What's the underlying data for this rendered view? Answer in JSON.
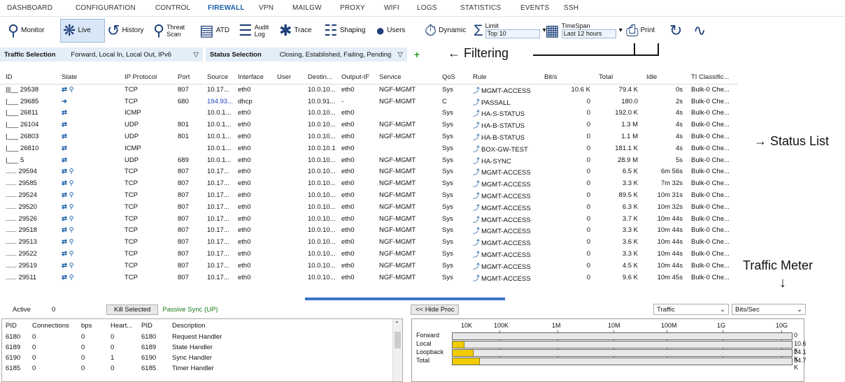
{
  "menu": [
    "DASHBOARD",
    "CONFIGURATION",
    "CONTROL",
    "FIREWALL",
    "VPN",
    "MAILGW",
    "PROXY",
    "WIFI",
    "LOGS",
    "STATISTICS",
    "EVENTS",
    "SSH"
  ],
  "toolbar": {
    "monitor": "Monitor",
    "live": "Live",
    "history": "History",
    "threat_l1": "Threat",
    "threat_l2": "Scan",
    "atd": "ATD",
    "audit_l1": "Audit",
    "audit_l2": "Log",
    "trace": "Trace",
    "shaping": "Shaping",
    "users": "Users",
    "dynamic": "Dynamic",
    "limit_label": "Limit",
    "limit_value": "Top 10",
    "timespan_label": "TimeSpan",
    "timespan_value": "Last 12 hours",
    "print": "Print"
  },
  "filter": {
    "traffic_label": "Traffic Selection",
    "traffic_value": "Forward, Local In, Local Out, IPv6",
    "status_label": "Status Selection",
    "status_value": "Closing, Established, Failing, Pending"
  },
  "annotations": {
    "filtering": "Filtering",
    "status_list": "Status List",
    "traffic_meter": "Traffic Meter"
  },
  "columns": [
    "ID",
    "State",
    "IP Protocol",
    "Port",
    "Source",
    "Interface",
    "User",
    "Destin...",
    "Output-IF",
    "Service",
    "QoS",
    "Rule",
    "Bit/s",
    "Total",
    "Idle",
    "TI Classific..."
  ],
  "rows": [
    {
      "id": "29538",
      "mark": "|||__",
      "proto": "TCP",
      "port": "807",
      "src": "10.17...",
      "if": "eth0",
      "user": "",
      "dst": "10.0.10...",
      "oif": "eth0",
      "svc": "NGF-MGMT",
      "qos": "Sys",
      "rule": "MGMT-ACCESS",
      "bits": "10.6 K",
      "total": "79.4 K",
      "idle": "0s",
      "ti": "Bulk-0 Che..."
    },
    {
      "id": "29685",
      "mark": "|___",
      "proto": "TCP",
      "port": "680",
      "src": "194.93...",
      "if": "dhcp",
      "user": "",
      "dst": "10.0.91....",
      "oif": "-",
      "svc": "NGF-MGMT",
      "qos": "C",
      "rule": "PASSALL",
      "bits": "0",
      "total": "180.0",
      "idle": "2s",
      "ti": "Bulk-0 Che..."
    },
    {
      "id": "26811",
      "mark": "|___",
      "proto": "ICMP",
      "port": "",
      "src": "10.0.1...",
      "if": "eth0",
      "user": "",
      "dst": "10.0.10...",
      "oif": "eth0",
      "svc": "",
      "qos": "Sys",
      "rule": "HA-S-STATUS",
      "bits": "0",
      "total": "192.0 K",
      "idle": "4s",
      "ti": "Bulk-0 Che..."
    },
    {
      "id": "26104",
      "mark": "|___",
      "proto": "UDP",
      "port": "801",
      "src": "10.0.1...",
      "if": "eth0",
      "user": "",
      "dst": "10.0.10...",
      "oif": "eth0",
      "svc": "NGF-MGMT",
      "qos": "Sys",
      "rule": "HA-B-STATUS",
      "bits": "0",
      "total": "1.3 M",
      "idle": "4s",
      "ti": "Bulk-0 Che..."
    },
    {
      "id": "26803",
      "mark": "|___",
      "proto": "UDP",
      "port": "801",
      "src": "10.0.1...",
      "if": "eth0",
      "user": "",
      "dst": "10.0.10...",
      "oif": "eth0",
      "svc": "NGF-MGMT",
      "qos": "Sys",
      "rule": "HA-B-STATUS",
      "bits": "0",
      "total": "1.1 M",
      "idle": "4s",
      "ti": "Bulk-0 Che..."
    },
    {
      "id": "26810",
      "mark": "|___",
      "proto": "ICMP",
      "port": "",
      "src": "10.0.1...",
      "if": "eth0",
      "user": "",
      "dst": "10.0.10.1",
      "oif": "eth0",
      "svc": "",
      "qos": "Sys",
      "rule": "BOX-GW-TEST",
      "bits": "0",
      "total": "181.1 K",
      "idle": "4s",
      "ti": "Bulk-0 Che..."
    },
    {
      "id": "5",
      "mark": "|___",
      "proto": "UDP",
      "port": "689",
      "src": "10.0.1...",
      "if": "eth0",
      "user": "",
      "dst": "10.0.10...",
      "oif": "eth0",
      "svc": "NGF-MGMT",
      "qos": "Sys",
      "rule": "HA-SYNC",
      "bits": "0",
      "total": "28.9 M",
      "idle": "5s",
      "ti": "Bulk-0 Che..."
    },
    {
      "id": "29594",
      "mark": "......",
      "proto": "TCP",
      "port": "807",
      "src": "10.17...",
      "if": "eth0",
      "user": "",
      "dst": "10.0.10...",
      "oif": "eth0",
      "svc": "NGF-MGMT",
      "qos": "Sys",
      "rule": "MGMT-ACCESS",
      "bits": "0",
      "total": "6.5 K",
      "idle": "6m 56s",
      "ti": "Bulk-0 Che..."
    },
    {
      "id": "29585",
      "mark": "......",
      "proto": "TCP",
      "port": "807",
      "src": "10.17...",
      "if": "eth0",
      "user": "",
      "dst": "10.0.10...",
      "oif": "eth0",
      "svc": "NGF-MGMT",
      "qos": "Sys",
      "rule": "MGMT-ACCESS",
      "bits": "0",
      "total": "3.3 K",
      "idle": "7m 32s",
      "ti": "Bulk-0 Che..."
    },
    {
      "id": "29524",
      "mark": "......",
      "proto": "TCP",
      "port": "807",
      "src": "10.17...",
      "if": "eth0",
      "user": "",
      "dst": "10.0.10...",
      "oif": "eth0",
      "svc": "NGF-MGMT",
      "qos": "Sys",
      "rule": "MGMT-ACCESS",
      "bits": "0",
      "total": "89.5 K",
      "idle": "10m 31s",
      "ti": "Bulk-0 Che..."
    },
    {
      "id": "29520",
      "mark": "......",
      "proto": "TCP",
      "port": "807",
      "src": "10.17...",
      "if": "eth0",
      "user": "",
      "dst": "10.0.10...",
      "oif": "eth0",
      "svc": "NGF-MGMT",
      "qos": "Sys",
      "rule": "MGMT-ACCESS",
      "bits": "0",
      "total": "6.3 K",
      "idle": "10m 32s",
      "ti": "Bulk-0 Che..."
    },
    {
      "id": "29526",
      "mark": "......",
      "proto": "TCP",
      "port": "807",
      "src": "10.17...",
      "if": "eth0",
      "user": "",
      "dst": "10.0.10...",
      "oif": "eth0",
      "svc": "NGF-MGMT",
      "qos": "Sys",
      "rule": "MGMT-ACCESS",
      "bits": "0",
      "total": "3.7 K",
      "idle": "10m 44s",
      "ti": "Bulk-0 Che..."
    },
    {
      "id": "29518",
      "mark": "......",
      "proto": "TCP",
      "port": "807",
      "src": "10.17...",
      "if": "eth0",
      "user": "",
      "dst": "10.0.10...",
      "oif": "eth0",
      "svc": "NGF-MGMT",
      "qos": "Sys",
      "rule": "MGMT-ACCESS",
      "bits": "0",
      "total": "3.3 K",
      "idle": "10m 44s",
      "ti": "Bulk-0 Che..."
    },
    {
      "id": "29513",
      "mark": "......",
      "proto": "TCP",
      "port": "807",
      "src": "10.17...",
      "if": "eth0",
      "user": "",
      "dst": "10.0.10...",
      "oif": "eth0",
      "svc": "NGF-MGMT",
      "qos": "Sys",
      "rule": "MGMT-ACCESS",
      "bits": "0",
      "total": "3.6 K",
      "idle": "10m 44s",
      "ti": "Bulk-0 Che..."
    },
    {
      "id": "29522",
      "mark": "......",
      "proto": "TCP",
      "port": "807",
      "src": "10.17...",
      "if": "eth0",
      "user": "",
      "dst": "10.0.10...",
      "oif": "eth0",
      "svc": "NGF-MGMT",
      "qos": "Sys",
      "rule": "MGMT-ACCESS",
      "bits": "0",
      "total": "3.3 K",
      "idle": "10m 44s",
      "ti": "Bulk-0 Che..."
    },
    {
      "id": "29519",
      "mark": "......",
      "proto": "TCP",
      "port": "807",
      "src": "10.17...",
      "if": "eth0",
      "user": "",
      "dst": "10.0.10...",
      "oif": "eth0",
      "svc": "NGF-MGMT",
      "qos": "Sys",
      "rule": "MGMT-ACCESS",
      "bits": "0",
      "total": "4.5 K",
      "idle": "10m 44s",
      "ti": "Bulk-0 Che..."
    },
    {
      "id": "29511",
      "mark": "......",
      "proto": "TCP",
      "port": "807",
      "src": "10.17...",
      "if": "eth0",
      "user": "",
      "dst": "10.0.10...",
      "oif": "eth0",
      "svc": "NGF-MGMT",
      "qos": "Sys",
      "rule": "MGMT-ACCESS",
      "bits": "0",
      "total": "9.6 K",
      "idle": "10m 45s",
      "ti": "Bulk-0 Che..."
    }
  ],
  "bottom_left": {
    "active_label": "Active",
    "active_value": "0",
    "kill": "Kill Selected",
    "sync": "Passive Sync (UP)",
    "columns": [
      "PID",
      "Connections",
      "bps",
      "Heart...",
      "PID",
      "Description"
    ],
    "rows": [
      [
        "6180",
        "0",
        "0",
        "0",
        "6180",
        "Request Handler"
      ],
      [
        "6189",
        "0",
        "0",
        "0",
        "6189",
        "State Handler"
      ],
      [
        "6190",
        "0",
        "0",
        "1",
        "6190",
        "Sync Handler"
      ],
      [
        "6185",
        "0",
        "0",
        "0",
        "6185",
        "Timer Handler"
      ]
    ]
  },
  "bottom_right": {
    "hide_proc": "<< Hide Proc",
    "traffic_select": "Traffic",
    "unit_select": "Bits/Sec",
    "scale": [
      "10K",
      "100K",
      "1M",
      "10M",
      "100M",
      "1G",
      "10G"
    ],
    "meters": [
      {
        "label": "Forward",
        "value": "0",
        "fill_pct": 0
      },
      {
        "label": "Local",
        "value": "10.6 K",
        "fill_pct": 3.5
      },
      {
        "label": "Loopback",
        "value": "24.1 K",
        "fill_pct": 6.2
      },
      {
        "label": "Total",
        "value": "34.7 K",
        "fill_pct": 8.0
      }
    ]
  },
  "colors": {
    "accent": "#1a5ea8",
    "meter_fill": "#f0cc00",
    "split_bar": "#3a74c8"
  }
}
